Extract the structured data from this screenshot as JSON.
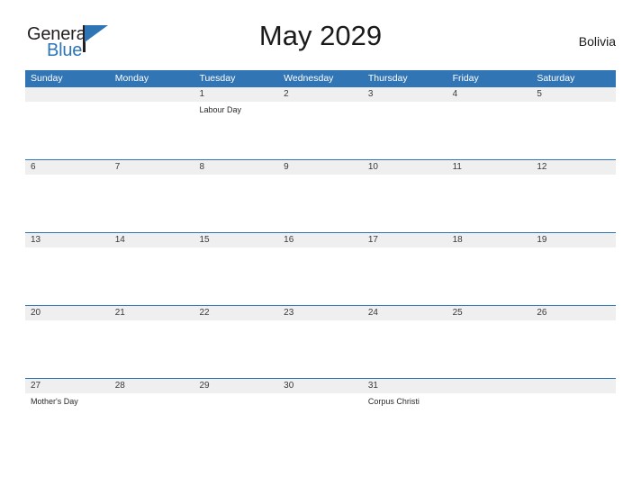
{
  "logo": {
    "word_top": "General",
    "word_bottom": "Blue",
    "triangle_icon": "triangle-icon",
    "accent_color": "#2e75b6"
  },
  "header": {
    "title": "May 2029",
    "country": "Bolivia"
  },
  "theme": {
    "header_blue": "#3175b5",
    "date_band_gray": "#efefef",
    "rule_blue": "#2e75b6",
    "text_dark": "#1a1a1a"
  },
  "calendar": {
    "weekdays": [
      "Sunday",
      "Monday",
      "Tuesday",
      "Wednesday",
      "Thursday",
      "Friday",
      "Saturday"
    ],
    "weeks": [
      {
        "days": [
          {
            "date": "",
            "events": []
          },
          {
            "date": "",
            "events": []
          },
          {
            "date": "1",
            "events": [
              "Labour Day"
            ]
          },
          {
            "date": "2",
            "events": []
          },
          {
            "date": "3",
            "events": []
          },
          {
            "date": "4",
            "events": []
          },
          {
            "date": "5",
            "events": []
          }
        ]
      },
      {
        "days": [
          {
            "date": "6",
            "events": []
          },
          {
            "date": "7",
            "events": []
          },
          {
            "date": "8",
            "events": []
          },
          {
            "date": "9",
            "events": []
          },
          {
            "date": "10",
            "events": []
          },
          {
            "date": "11",
            "events": []
          },
          {
            "date": "12",
            "events": []
          }
        ]
      },
      {
        "days": [
          {
            "date": "13",
            "events": []
          },
          {
            "date": "14",
            "events": []
          },
          {
            "date": "15",
            "events": []
          },
          {
            "date": "16",
            "events": []
          },
          {
            "date": "17",
            "events": []
          },
          {
            "date": "18",
            "events": []
          },
          {
            "date": "19",
            "events": []
          }
        ]
      },
      {
        "days": [
          {
            "date": "20",
            "events": []
          },
          {
            "date": "21",
            "events": []
          },
          {
            "date": "22",
            "events": []
          },
          {
            "date": "23",
            "events": []
          },
          {
            "date": "24",
            "events": []
          },
          {
            "date": "25",
            "events": []
          },
          {
            "date": "26",
            "events": []
          }
        ]
      },
      {
        "days": [
          {
            "date": "27",
            "events": [
              "Mother's Day"
            ]
          },
          {
            "date": "28",
            "events": []
          },
          {
            "date": "29",
            "events": []
          },
          {
            "date": "30",
            "events": []
          },
          {
            "date": "31",
            "events": [
              "Corpus Christi"
            ]
          },
          {
            "date": "",
            "events": []
          },
          {
            "date": "",
            "events": []
          }
        ]
      }
    ]
  }
}
